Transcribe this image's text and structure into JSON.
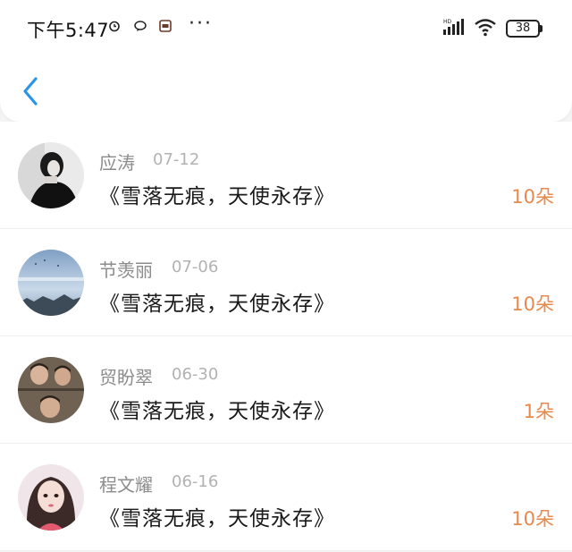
{
  "status_bar": {
    "time": "下午5:47",
    "more": "···",
    "battery": "38"
  },
  "colors": {
    "accent": "#2a94e8",
    "count": "#e8884a",
    "name": "#8c8c8c",
    "date": "#b2b2b2"
  },
  "records": [
    {
      "name": "应涛",
      "date": "07-12",
      "title": "《雪落无痕，天使永存》",
      "count": "10朵",
      "avatar_icon": "avatar-woman-dark-photo"
    },
    {
      "name": "节羡丽",
      "date": "07-06",
      "title": "《雪落无痕，天使永存》",
      "count": "10朵",
      "avatar_icon": "avatar-sky-photo"
    },
    {
      "name": "贸盼翠",
      "date": "06-30",
      "title": "《雪落无痕，天使永存》",
      "count": "1朵",
      "avatar_icon": "avatar-kids-photo"
    },
    {
      "name": "程文耀",
      "date": "06-16",
      "title": "《雪落无痕，天使永存》",
      "count": "10朵",
      "avatar_icon": "avatar-girl-portrait"
    }
  ]
}
